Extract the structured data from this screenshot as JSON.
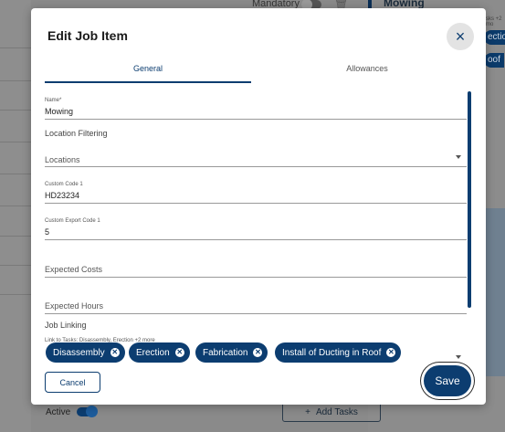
{
  "background": {
    "mandatory_label": "Mandatory",
    "right_panel_title": "Mowing",
    "right_panel_sub": "sks +2 mo",
    "right_chip_1": "ectio",
    "right_chip_2": "oof",
    "active_label": "Active",
    "add_tasks_label": "Add Tasks",
    "add_tasks_icon": "+"
  },
  "modal": {
    "title": "Edit Job Item",
    "close_icon": "×",
    "tabs": [
      {
        "label": "General",
        "active": true
      },
      {
        "label": "Allowances",
        "active": false
      }
    ],
    "fields": {
      "name": {
        "label": "Name*",
        "value": "Mowing"
      },
      "location_filtering": {
        "label": "Location Filtering"
      },
      "locations": {
        "placeholder": "Locations"
      },
      "custom_code_1": {
        "label": "Custom Code 1",
        "value": "HD23234"
      },
      "custom_export_code_1": {
        "label": "Custom Export Code 1",
        "value": "5"
      },
      "expected_costs": {
        "placeholder": "Expected Costs"
      },
      "expected_hours": {
        "placeholder": "Expected Hours"
      },
      "job_linking": {
        "label": "Job Linking"
      },
      "link_to_tasks": {
        "label": "Link to Tasks: Disassembly, Erection +2 more"
      }
    },
    "chips": [
      "Disassembly",
      "Erection",
      "Fabrication",
      "Install of Ducting in Roof"
    ],
    "chip_remove_icon": "✕",
    "cancel_label": "Cancel",
    "save_label": "Save"
  },
  "colors": {
    "primary": "#0c3d70",
    "overlay": "#8a8a8a"
  }
}
